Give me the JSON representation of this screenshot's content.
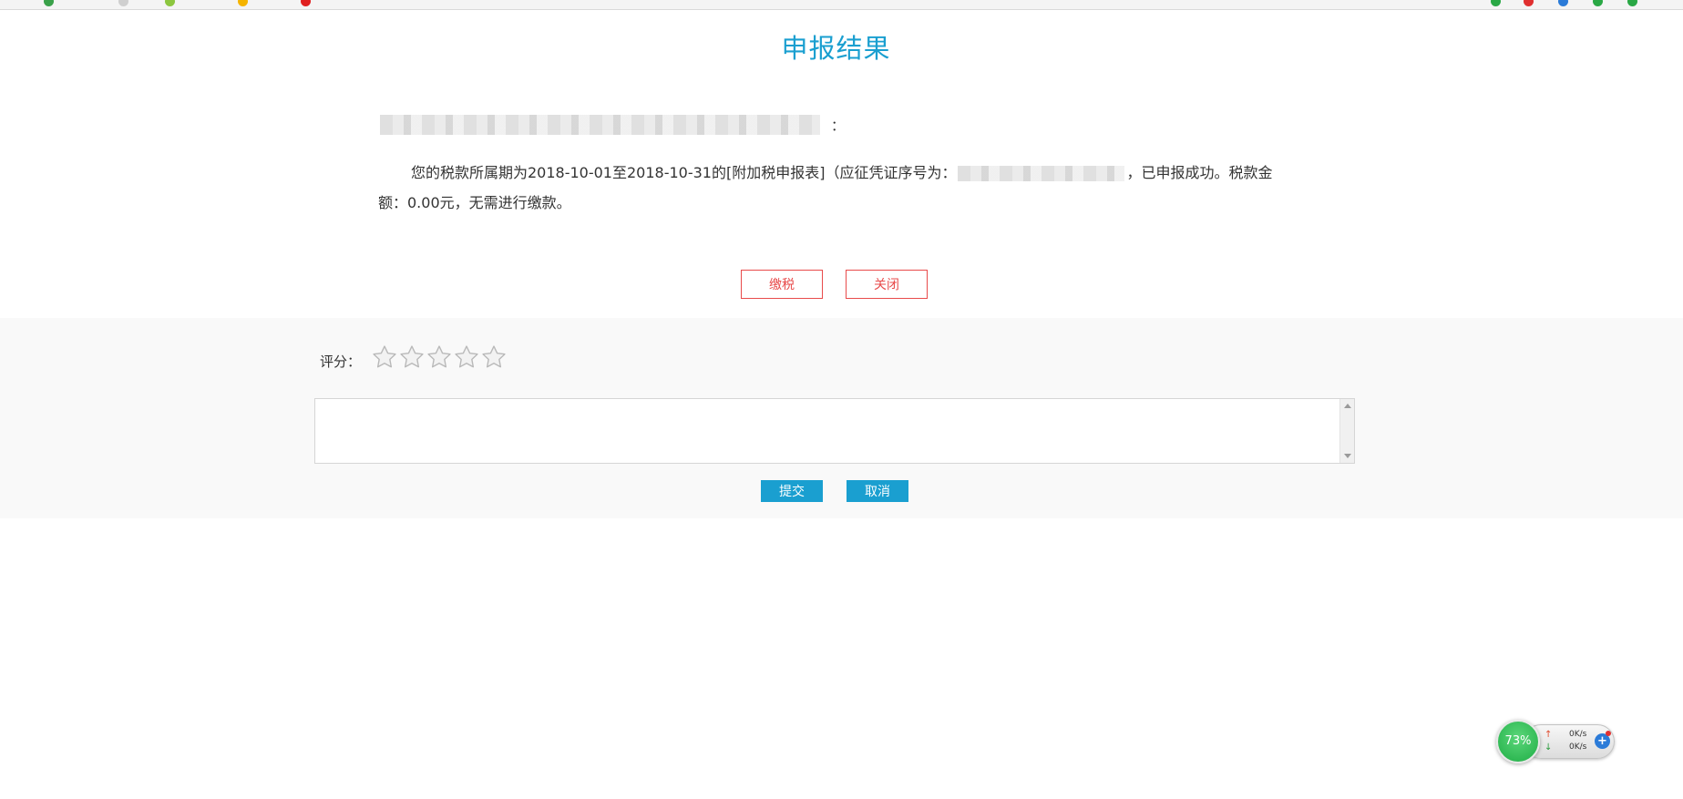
{
  "page": {
    "title": "申报结果"
  },
  "result": {
    "greeting_suffix": "：",
    "message_before": "您的税款所属期为2018-10-01至2018-10-31的[附加税申报表]（应征凭证序号为：",
    "message_after": "，已申报成功。税款金额：0.00元，无需进行缴款。"
  },
  "actions": {
    "pay_label": "缴税",
    "close_label": "关闭"
  },
  "feedback": {
    "score_label": "评分：",
    "star_count": 5,
    "submit_label": "提交",
    "cancel_label": "取消"
  },
  "net_widget": {
    "percent": "73%",
    "upload_speed": "0K/s",
    "download_speed": "0K/s"
  },
  "colors": {
    "accent": "#1a9fd0",
    "danger": "#e84b4b",
    "feedback_bg": "#f9f9f9"
  }
}
